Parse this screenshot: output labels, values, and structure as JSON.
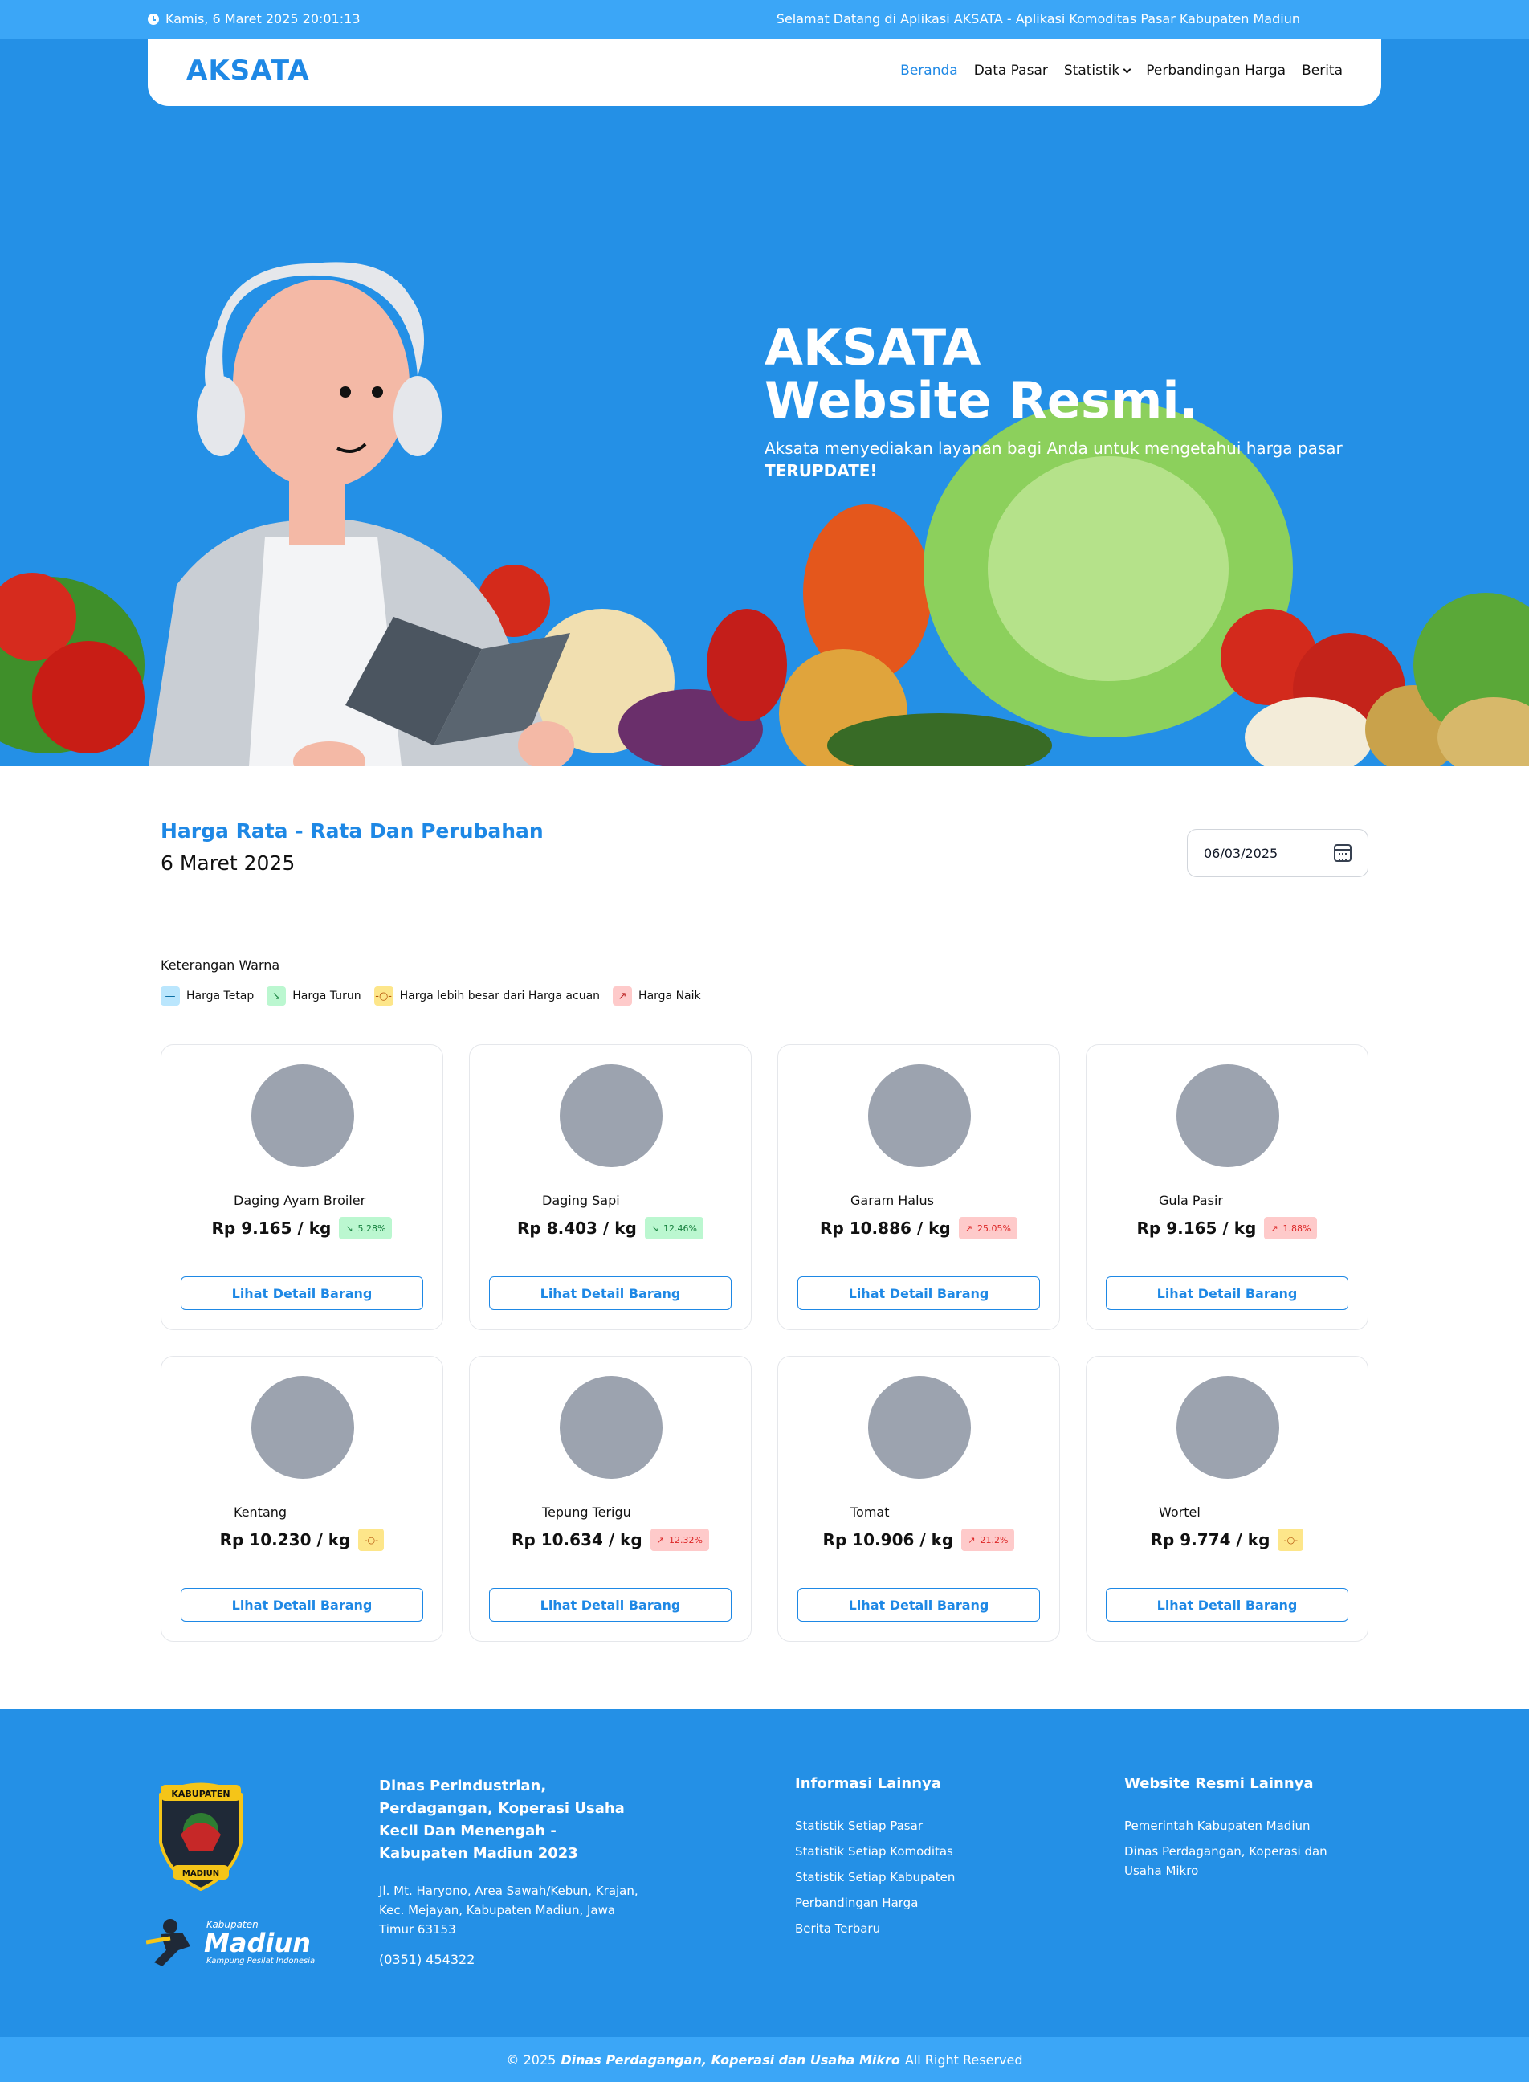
{
  "topbar": {
    "datetime": "Kamis, 6 Maret 2025 20:01:13",
    "welcome": "Selamat Datang di Aplikasi AKSATA - Aplikasi Komoditas Pasar Kabupaten Madiun"
  },
  "nav": {
    "brand": "AKSATA",
    "items": [
      "Beranda",
      "Data Pasar",
      "Statistik",
      "Perbandingan Harga",
      "Berita"
    ],
    "active": "Beranda"
  },
  "hero": {
    "title_line1": "AKSATA",
    "title_line2": "Website Resmi.",
    "subtitle": "Aksata menyediakan layanan bagi Anda untuk mengetahui harga pasar",
    "subtitle_bold": "TERUPDATE!"
  },
  "section": {
    "title": "Harga Rata - Rata Dan Perubahan",
    "date": "6 Maret 2025",
    "date_input_value": "06/03/2025"
  },
  "legend": {
    "title": "Keterangan Warna",
    "items": [
      {
        "label": "Harga Tetap",
        "icon": "dash-icon",
        "color": "#bae6fd"
      },
      {
        "label": "Harga Turun",
        "icon": "arrow-down-right-icon",
        "color": "#bbf7d0"
      },
      {
        "label": "Harga lebih besar dari Harga acuan",
        "icon": "reference-icon",
        "color": "#fde68a"
      },
      {
        "label": "Harga Naik",
        "icon": "arrow-up-right-icon",
        "color": "#fecaca"
      }
    ]
  },
  "button_label": "Lihat Detail Barang",
  "products": [
    {
      "name": "Daging Ayam Broiler",
      "price": "Rp 9.165 / kg",
      "status": "down",
      "change": "5.28%"
    },
    {
      "name": "Daging Sapi",
      "price": "Rp 8.403 / kg",
      "status": "down",
      "change": "12.46%"
    },
    {
      "name": "Garam Halus",
      "price": "Rp 10.886 / kg",
      "status": "up",
      "change": "25.05%"
    },
    {
      "name": "Gula Pasir",
      "price": "Rp 9.165 / kg",
      "status": "up",
      "change": "1.88%"
    },
    {
      "name": "Kentang",
      "price": "Rp 10.230 / kg",
      "status": "ref",
      "change": ""
    },
    {
      "name": "Tepung Terigu",
      "price": "Rp 10.634 / kg",
      "status": "up",
      "change": "12.32%"
    },
    {
      "name": "Tomat",
      "price": "Rp 10.906 / kg",
      "status": "up",
      "change": "21.2%"
    },
    {
      "name": "Wortel",
      "price": "Rp 9.774 / kg",
      "status": "ref",
      "change": ""
    }
  ],
  "footer": {
    "org": "Dinas Perindustrian, Perdagangan, Koperasi Usaha Kecil Dan Menengah - Kabupaten Madiun 2023",
    "address": "Jl. Mt. Haryono, Area Sawah/Kebun, Krajan, Kec. Mejayan, Kabupaten Madiun, Jawa Timur 63153",
    "phone": "(0351) 454322",
    "info_title": "Informasi Lainnya",
    "info_links": [
      "Statistik Setiap Pasar",
      "Statistik Setiap Komoditas",
      "Statistik Setiap Kabupaten",
      "Perbandingan Harga",
      "Berita Terbaru"
    ],
    "sites_title": "Website Resmi Lainnya",
    "sites_links": [
      "Pemerintah Kabupaten Madiun",
      "Dinas Perdagangan, Koperasi dan Usaha Mikro"
    ],
    "crest_text_top": "KABUPATEN",
    "crest_text_bottom": "MADIUN",
    "logo_small": "Kabupaten",
    "logo_big": "Madiun",
    "logo_tagline": "Kampung Pesilat Indonesia"
  },
  "copyright": {
    "prefix": "© 2025",
    "org": "Dinas Perdagangan, Koperasi dan Usaha Mikro",
    "suffix": "All Right Reserved"
  }
}
